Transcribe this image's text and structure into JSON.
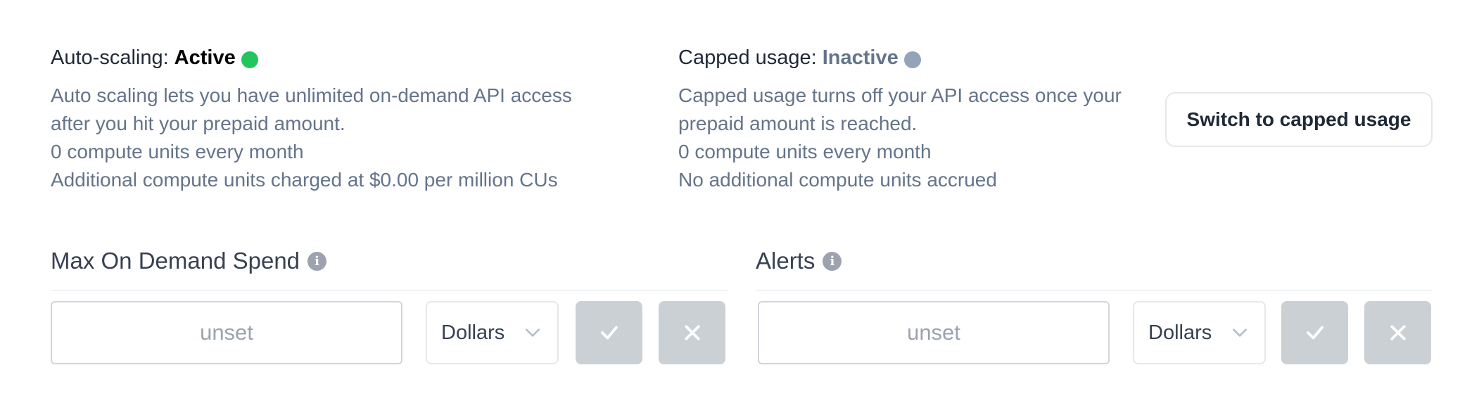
{
  "auto_scaling": {
    "label": "Auto-scaling:",
    "status": "Active",
    "status_color": "#22c55e",
    "lines": [
      "Auto scaling lets you have unlimited on-demand API access after you hit your prepaid amount.",
      "0 compute units every month",
      "Additional compute units charged at $0.00 per million CUs"
    ]
  },
  "capped_usage": {
    "label": "Capped usage:",
    "status": "Inactive",
    "status_color": "#94a3b8",
    "lines": [
      "Capped usage turns off your API access once your prepaid amount is reached.",
      "0 compute units every month",
      "No additional compute units accrued"
    ],
    "switch_button": "Switch to capped usage"
  },
  "max_spend": {
    "title": "Max On Demand Spend",
    "info_icon": "info-icon",
    "input_placeholder": "unset",
    "unit": "Dollars",
    "confirm_icon": "check-icon",
    "cancel_icon": "x-icon"
  },
  "alerts": {
    "title": "Alerts",
    "info_icon": "info-icon",
    "input_placeholder": "unset",
    "unit": "Dollars",
    "confirm_icon": "check-icon",
    "cancel_icon": "x-icon"
  },
  "colors": {
    "heading": "#1f2937",
    "muted_text": "#64748b",
    "disabled_button": "#cbd0d5"
  }
}
